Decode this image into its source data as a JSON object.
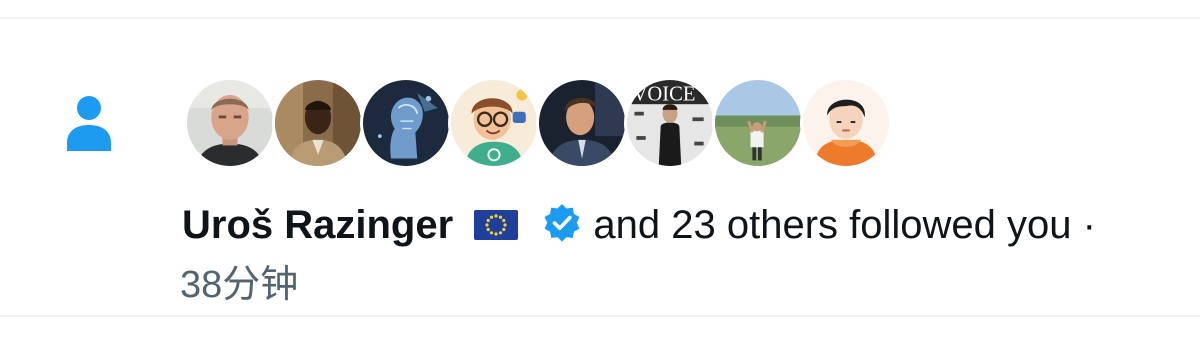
{
  "notification": {
    "type_icon": "person-icon",
    "colors": {
      "accent": "#1d9bf0",
      "text_primary": "#0f1419",
      "text_secondary": "#536471",
      "divider": "#eff3f4"
    },
    "avatars": [
      {
        "name": "avatar-uros-razinger",
        "description": "man with short hair, grey background"
      },
      {
        "name": "avatar-2",
        "description": "man in suit, brown background"
      },
      {
        "name": "avatar-3",
        "description": "blue digital AI head"
      },
      {
        "name": "avatar-4",
        "description": "cartoon man with glasses and green shirt"
      },
      {
        "name": "avatar-5",
        "description": "young man in suit, dark background"
      },
      {
        "name": "avatar-6",
        "description": "man at event in front of step-and-repeat banner"
      },
      {
        "name": "avatar-7",
        "description": "person standing in a field"
      },
      {
        "name": "avatar-8",
        "description": "cartoon boy with orange hoodie"
      }
    ],
    "user_name": "Uroš Razinger",
    "flag_icon": "eu-flag-icon",
    "verified_icon": "verified-badge-icon",
    "message": "and 23 others followed you ·",
    "time": "38分钟"
  }
}
